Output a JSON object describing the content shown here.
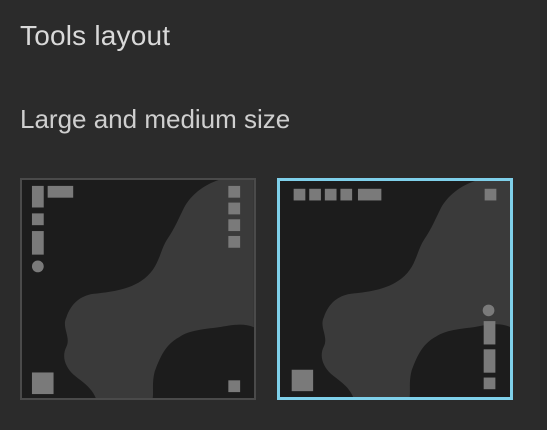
{
  "section": {
    "title": "Tools layout",
    "subtitle": "Large and medium size"
  },
  "options": [
    {
      "id": "layout-vertical-left",
      "selected": false
    },
    {
      "id": "layout-horizontal-top",
      "selected": true
    }
  ],
  "colors": {
    "background": "#2b2b2b",
    "map_dark": "#1c1c1c",
    "map_light": "#3a3a3a",
    "tool": "#7a7a7a",
    "selected_border": "#7fd0ea",
    "unselected_border": "#4a4a4a",
    "title_text": "#d9d9d9"
  }
}
